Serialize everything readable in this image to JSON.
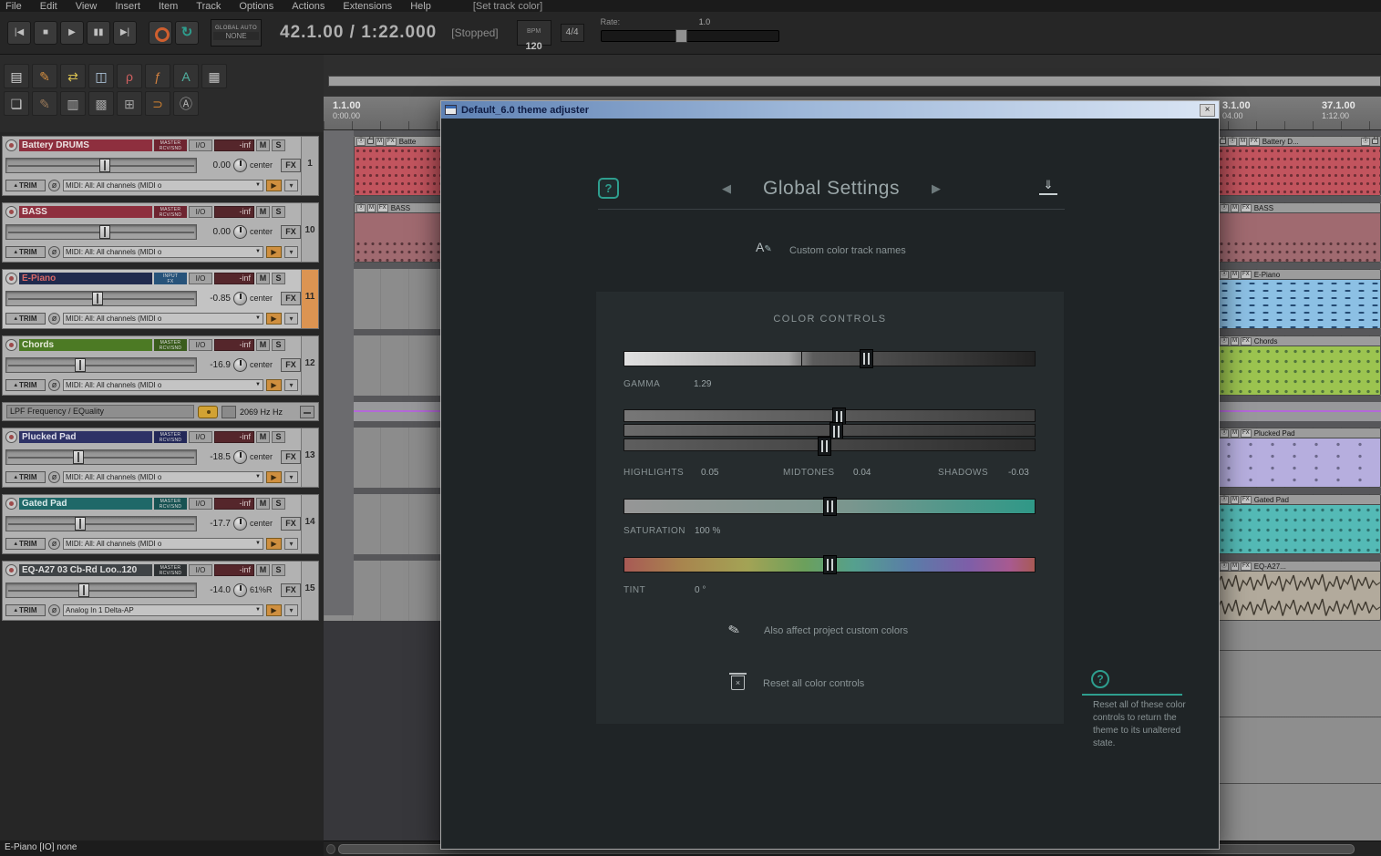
{
  "colors": {
    "accent_teal": "#2e9e8e",
    "titlebar_left": "#5f82b4",
    "titlebar_right": "#dae5f4",
    "dialog_bg": "#1f2426",
    "panel_bg": "#262c2e",
    "envelope_line": "#b468d8"
  },
  "menubar": {
    "items": [
      "File",
      "Edit",
      "View",
      "Insert",
      "Item",
      "Track",
      "Options",
      "Actions",
      "Extensions",
      "Help"
    ],
    "set_track_color": "[Set track color]"
  },
  "transport": {
    "icons": {
      "goto_start": "|◀",
      "stop": "■",
      "play": "▶",
      "pause": "▮▮",
      "goto_end": "▶|",
      "repeat": "↻"
    },
    "global_auto_label": "GLOBAL AUTO",
    "global_auto_value": "NONE",
    "time": "42.1.00 / 1:22.000",
    "status": "[Stopped]",
    "bpm_label": "BPM",
    "bpm_value": "120",
    "time_sig": "4/4",
    "rate_label": "Rate:",
    "rate_value": "1.0",
    "rate_pos": 46
  },
  "toolbar": {
    "buttons": [
      {
        "name": "item-doc",
        "glyph": "▤",
        "color": "#d8d8d8"
      },
      {
        "name": "pencil-edit",
        "glyph": "✎",
        "color": "#d89040"
      },
      {
        "name": "swap-arrows",
        "glyph": "⇄",
        "color": "#d8c050"
      },
      {
        "name": "item-properties",
        "glyph": "◫",
        "color": "#b8d0e8"
      },
      {
        "name": "lasso",
        "glyph": "ρ",
        "color": "#d06060"
      },
      {
        "name": "envelope-function",
        "glyph": "ƒ",
        "color": "#d08040"
      },
      {
        "name": "theme-letter",
        "glyph": "A",
        "color": "#50b0a0"
      },
      {
        "name": "grid",
        "glyph": "▦",
        "color": "#c0c0c0"
      },
      {
        "name": "docs",
        "glyph": "❏",
        "color": "#d0d0d0"
      },
      {
        "name": "pencil-dark",
        "glyph": "✎",
        "color": "#9a7a5a"
      },
      {
        "name": "grid-alt",
        "glyph": "▥",
        "color": "#b0b0b0"
      },
      {
        "name": "pattern",
        "glyph": "▩",
        "color": "#a0a0a0"
      },
      {
        "name": "grid-plus",
        "glyph": "⊞",
        "color": "#a0a0a0"
      },
      {
        "name": "loop-tool",
        "glyph": "⊃",
        "color": "#d08030"
      },
      {
        "name": "lock-a",
        "glyph": "Ⓐ",
        "color": "#b0b0b0"
      }
    ]
  },
  "ui_icons": {
    "dd_arrow": "▼",
    "tri_up": "▴",
    "in_arrow": "▾",
    "play_small": "▶"
  },
  "tcp": {
    "tracks": [
      {
        "num": "1",
        "name": "Battery DRUMS",
        "name_bg": "#8e2f3e",
        "name_fg": "#ece2e2",
        "badge1": "MASTER",
        "badge2": "RCV/SND",
        "badge_bg": "#6e2430",
        "io": "I/O",
        "peak": "-inf",
        "mute": "M",
        "solo": "S",
        "vol": "0.00",
        "pan": "center",
        "fx": "FX",
        "trim": "TRIM",
        "phase": "ø",
        "input": "MIDI: All: All channels (MIDI o",
        "fader_pct": 52,
        "selected": false,
        "item_bg": "#c2545e"
      },
      {
        "num": "10",
        "name": "BASS",
        "name_bg": "#8e2f3e",
        "name_fg": "#ece2e2",
        "badge1": "MASTER",
        "badge2": "RCV/SND",
        "badge_bg": "#6e2430",
        "io": "I/O",
        "peak": "-inf",
        "mute": "M",
        "solo": "S",
        "vol": "0.00",
        "pan": "center",
        "fx": "FX",
        "trim": "TRIM",
        "phase": "ø",
        "input": "MIDI: All: All channels (MIDI o",
        "fader_pct": 52,
        "selected": false,
        "item_bg": "#a06a70"
      },
      {
        "num": "11",
        "name": "E-Piano",
        "name_bg": "#202a4e",
        "name_fg": "#d86868",
        "badge1": "INPUT",
        "badge2": "FX",
        "badge_bg": "#27537a",
        "io": "I/O",
        "peak": "-inf",
        "mute": "M",
        "solo": "S",
        "vol": "-0.85",
        "pan": "center",
        "fx": "FX",
        "trim": "TRIM",
        "phase": "ø",
        "input": "MIDI: All: All channels (MIDI o",
        "fader_pct": 48,
        "selected": true,
        "item_bg": "#8cc0e4"
      },
      {
        "num": "12",
        "name": "Chords",
        "name_bg": "#4c7a24",
        "name_fg": "#e8ecdc",
        "badge1": "MASTER",
        "badge2": "RCV/SND",
        "badge_bg": "#3a5c1c",
        "io": "I/O",
        "peak": "-inf",
        "mute": "M",
        "solo": "S",
        "vol": "-16.9",
        "pan": "center",
        "fx": "FX",
        "trim": "TRIM",
        "phase": "ø",
        "input": "MIDI: All: All channels (MIDI o",
        "fader_pct": 39,
        "selected": false,
        "item_bg": "#9cc450"
      },
      {
        "num": "13",
        "name": "Plucked Pad",
        "name_bg": "#2e3266",
        "name_fg": "#e0e0ec",
        "badge1": "MASTER",
        "badge2": "RCV/SND",
        "badge_bg": "#232858",
        "io": "I/O",
        "peak": "-inf",
        "mute": "M",
        "solo": "S",
        "vol": "-18.5",
        "pan": "center",
        "fx": "FX",
        "trim": "TRIM",
        "phase": "ø",
        "input": "MIDI: All: All channels (MIDI o",
        "fader_pct": 38,
        "selected": false,
        "item_bg": "#b6aede"
      },
      {
        "num": "14",
        "name": "Gated Pad",
        "name_bg": "#1f6868",
        "name_fg": "#dcecec",
        "badge1": "MASTER",
        "badge2": "RCV/SND",
        "badge_bg": "#175252",
        "io": "I/O",
        "peak": "-inf",
        "mute": "M",
        "solo": "S",
        "vol": "-17.7",
        "pan": "center",
        "fx": "FX",
        "trim": "TRIM",
        "phase": "ø",
        "input": "MIDI: All: All channels (MIDI o",
        "fader_pct": 39,
        "selected": false,
        "item_bg": "#54bab6"
      },
      {
        "num": "15",
        "name": "EQ-A27 03 Cb-Rd Loo..120",
        "name_bg": "#3f4346",
        "name_fg": "#e0e0e0",
        "badge1": "MASTER",
        "badge2": "RCV/SND",
        "badge_bg": "#2e3234",
        "io": "I/O",
        "peak": "-inf",
        "mute": "M",
        "solo": "S",
        "vol": "-14.0",
        "pan": "61%R",
        "fx": "FX",
        "trim": "TRIM",
        "phase": "ø",
        "input": "Analog In 1 Delta-AP",
        "fader_pct": 41,
        "selected": false,
        "item_bg": "#b2aa9c"
      }
    ],
    "envelope": {
      "name": "LPF Frequency / EQuality",
      "value": "2069 Hz Hz"
    }
  },
  "ruler": {
    "l1_bar": "1.1.00",
    "l1_time": "0:00.00",
    "r1_bar": "3.1.00",
    "r1_time": "04.00",
    "r2_bar": "37.1.00",
    "r2_time": "1:12.00"
  },
  "arrange": {
    "header_tokens": {
      "arm": "ⓐ",
      "mute": "M",
      "fx": "FX"
    },
    "left_items": [
      {
        "name": "Batte"
      },
      {
        "name": "BASS"
      }
    ],
    "right_items": [
      {
        "name": "Battery D..."
      },
      {
        "name": "BASS"
      },
      {
        "name": "E-Piano"
      },
      {
        "name": "Chords"
      },
      {
        "name": "Plucked Pad"
      },
      {
        "name": "Gated Pad"
      },
      {
        "name": "EQ-A27..."
      }
    ]
  },
  "dialog": {
    "title": "Default_6.0 theme adjuster",
    "close": "×",
    "help": "?",
    "nav": {
      "prev": "◀",
      "title": "Global Settings",
      "next": "▶"
    },
    "download_icon": "⇓",
    "custom_color_icon": "A",
    "custom_color_pencil": "✎",
    "custom_color_label": "Custom color track names",
    "panel_title": "COLOR CONTROLS",
    "gamma": {
      "label": "GAMMA",
      "value": "1.29",
      "pos": 59
    },
    "highlights": {
      "label": "HIGHLIGHTS",
      "value": "0.05",
      "pos": 52.4
    },
    "midtones": {
      "label": "MIDTONES",
      "value": "0.04",
      "pos": 51.8
    },
    "shadows": {
      "label": "SHADOWS",
      "value": "-0.03",
      "pos": 48.9
    },
    "saturation": {
      "label": "SATURATION",
      "value": "100 %",
      "pos": 50.2
    },
    "tint": {
      "label": "TINT",
      "value": "0 °",
      "pos": 50.2
    },
    "brush_icon": "✎",
    "also_affect_label": "Also affect project custom colors",
    "trash_icon": "×",
    "reset_label": "Reset all color controls",
    "side_help": {
      "icon": "?",
      "text": "Reset all of these color controls to return the theme to its unaltered state."
    }
  },
  "statusbar": {
    "text": "E-Piano [IO] none"
  }
}
